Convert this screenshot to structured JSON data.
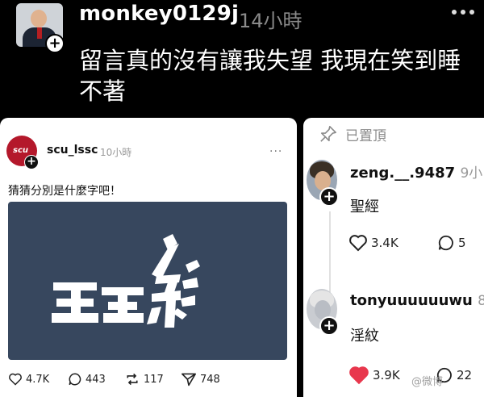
{
  "main_post": {
    "username": "monkey0129j",
    "time": "14小時",
    "text": "留言真的沒有讓我失望 我現在笑到睡不著"
  },
  "quoted_post": {
    "avatar_text": "scu",
    "username": "scu_lssc",
    "time": "10小時",
    "more": "···",
    "caption": "猜猜分別是什麼字吧！",
    "image_glyphs": [
      "王",
      "糸"
    ],
    "image_bg_color": "#37475e",
    "stats": {
      "likes": "4.7K",
      "comments": "443",
      "reposts": "117",
      "shares": "748"
    }
  },
  "comments_panel": {
    "pinned_label": "已置頂",
    "comments": [
      {
        "username": "zeng.__.9487",
        "time": "9小",
        "text": "聖經",
        "likes": "3.4K",
        "replies": "5",
        "liked": false
      },
      {
        "username": "tonyuuuuuuwu",
        "time": "8",
        "text": "淫紋",
        "likes": "3.9K",
        "replies": "22",
        "liked": true
      }
    ]
  },
  "watermark": "@微博",
  "colors": {
    "background": "#000000",
    "card": "#ffffff",
    "liked_heart": "#e8374d",
    "muted_text": "#8a8a8a"
  }
}
